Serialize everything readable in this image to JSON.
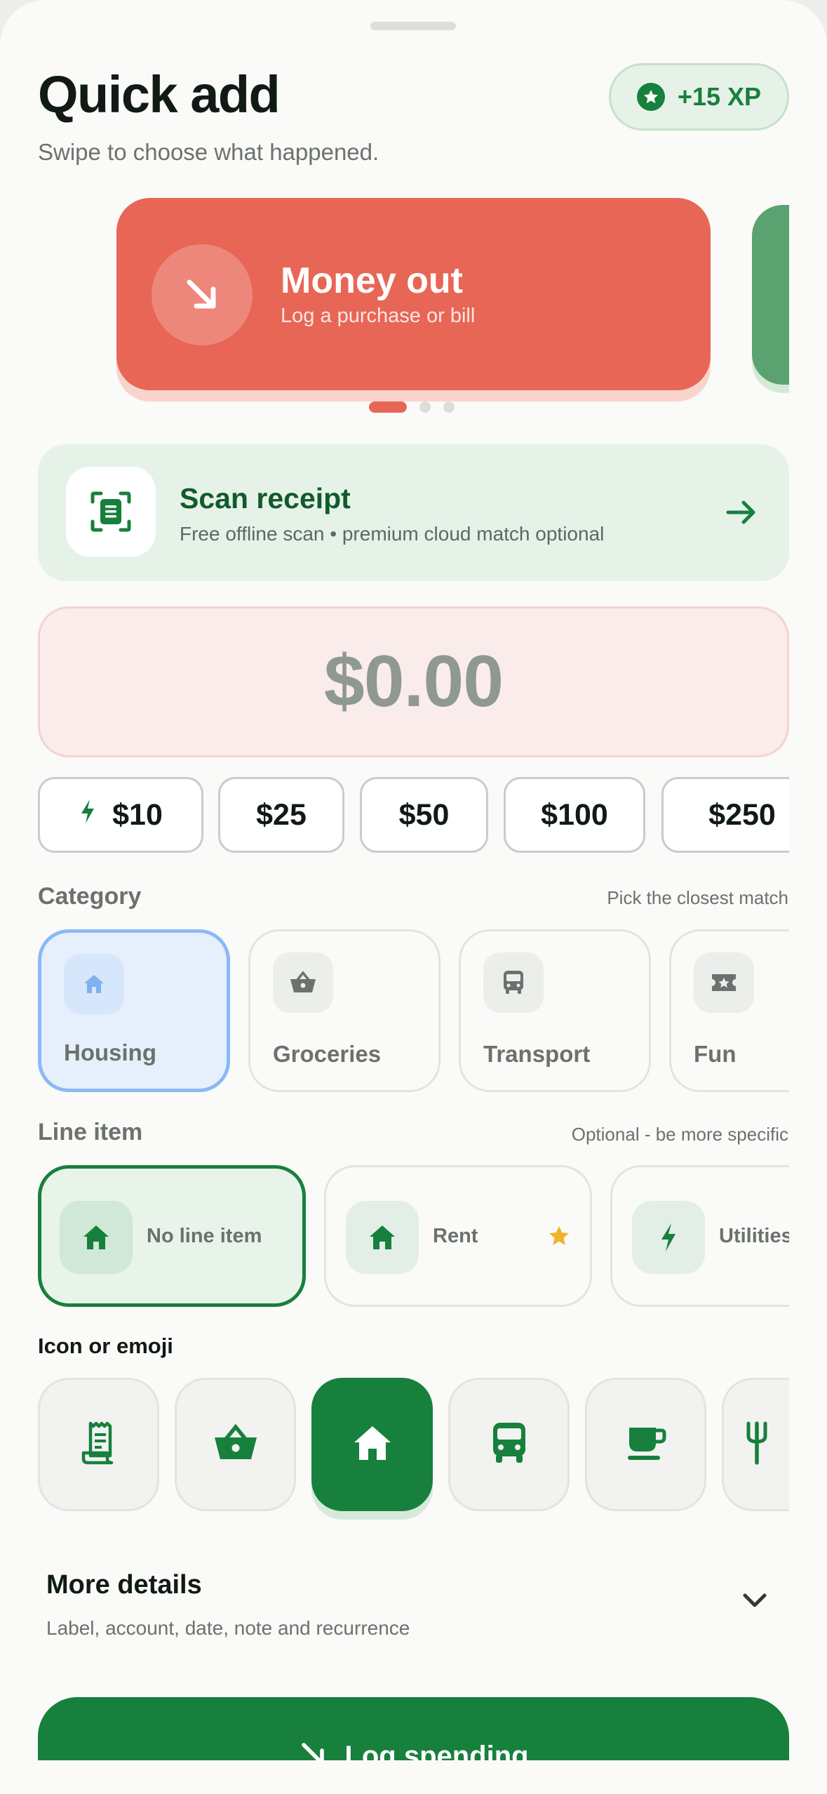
{
  "header": {
    "title": "Quick add",
    "subtitle": "Swipe to choose what happened.",
    "xp_badge": "+15 XP"
  },
  "type_carousel": {
    "active": {
      "title": "Money out",
      "description": "Log a purchase or bill",
      "color": "#e86656"
    },
    "next_color": "#5aa26f",
    "page_count": 3,
    "active_index": 0
  },
  "scan_receipt": {
    "title": "Scan receipt",
    "description": "Free offline scan • premium cloud match optional"
  },
  "amount": {
    "value": "$0.00"
  },
  "quick_amounts": [
    "$10",
    "$25",
    "$50",
    "$100",
    "$250"
  ],
  "category": {
    "label": "Category",
    "hint": "Pick the closest match",
    "items": [
      {
        "label": "Housing",
        "icon": "home-icon",
        "selected": true
      },
      {
        "label": "Groceries",
        "icon": "basket-icon",
        "selected": false
      },
      {
        "label": "Transport",
        "icon": "bus-icon",
        "selected": false
      },
      {
        "label": "Fun",
        "icon": "ticket-icon",
        "selected": false
      }
    ]
  },
  "line_item": {
    "label": "Line item",
    "hint": "Optional - be more specific",
    "items": [
      {
        "label": "No line item",
        "icon": "home-icon",
        "selected": true
      },
      {
        "label": "Rent",
        "icon": "home-icon",
        "starred": true
      },
      {
        "label": "Utilities",
        "icon": "bolt-icon"
      }
    ]
  },
  "icon_picker": {
    "label": "Icon or emoji",
    "icons": [
      "receipt-icon",
      "basket-icon",
      "home-icon",
      "bus-icon",
      "coffee-icon",
      "fork-icon"
    ],
    "selected_index": 2
  },
  "more_details": {
    "title": "More details",
    "description": "Label, account, date, note and recurrence"
  },
  "primary_action": {
    "label": "Log spending"
  },
  "colors": {
    "primary_green": "#17803c",
    "money_out_red": "#e86656",
    "selected_blue": "#8ab9f5",
    "star_gold": "#f0b429"
  }
}
